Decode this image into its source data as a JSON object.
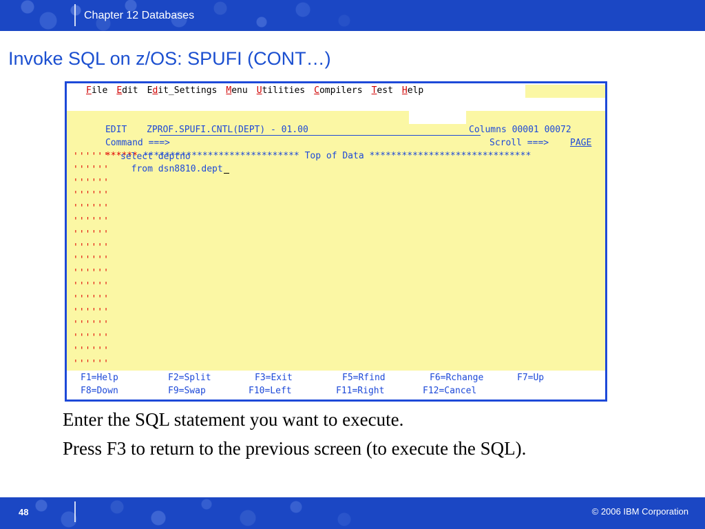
{
  "header": {
    "chapter": "Chapter 12 Databases",
    "slide_title": "Invoke SQL on z/OS: SPUFI (CONT…)"
  },
  "terminal": {
    "menu": [
      {
        "hot": "F",
        "rest": "ile"
      },
      {
        "hot": "E",
        "rest": "dit"
      },
      {
        "pre": "E",
        "hot": "d",
        "rest": "it_Settings"
      },
      {
        "hot": "M",
        "rest": "enu"
      },
      {
        "hot": "U",
        "rest": "tilities"
      },
      {
        "hot": "C",
        "rest": "ompilers"
      },
      {
        "hot": "T",
        "rest": "est"
      },
      {
        "hot": "H",
        "rest": "elp"
      }
    ],
    "edit_label": "EDIT",
    "dataset": "ZPROF.SPUFI.CNTL(DEPT) - 01.00",
    "columns": "Columns 00001 00072",
    "command_prompt": "Command ===>",
    "scroll_prompt": "Scroll ===>",
    "scroll_value": "PAGE",
    "top_marker": "******",
    "top_of_data": "***************************** Top of Data ******************************",
    "line_prefix": "''''''",
    "code_lines": [
      "select deptno",
      "  from dsn8810.dept"
    ],
    "fkeys_row1": [
      "F1=Help",
      "F2=Split",
      "F3=Exit",
      "F5=Rfind",
      "F6=Rchange",
      "F7=Up"
    ],
    "fkeys_row2": [
      "F8=Down",
      "F9=Swap",
      "F10=Left",
      "F11=Right",
      "F12=Cancel"
    ]
  },
  "body": {
    "line1": "Enter the SQL statement you want to execute.",
    "line2": "Press F3 to return to the previous screen (to execute the SQL)."
  },
  "footer": {
    "page_number": "48",
    "copyright": "© 2006 IBM Corporation"
  },
  "colors": {
    "banner": "#1b47c4",
    "title": "#1b4fd0",
    "terminal_text": "#1d49d8",
    "terminal_bg": "#fbf7a4",
    "hotkey": "#d00000"
  }
}
